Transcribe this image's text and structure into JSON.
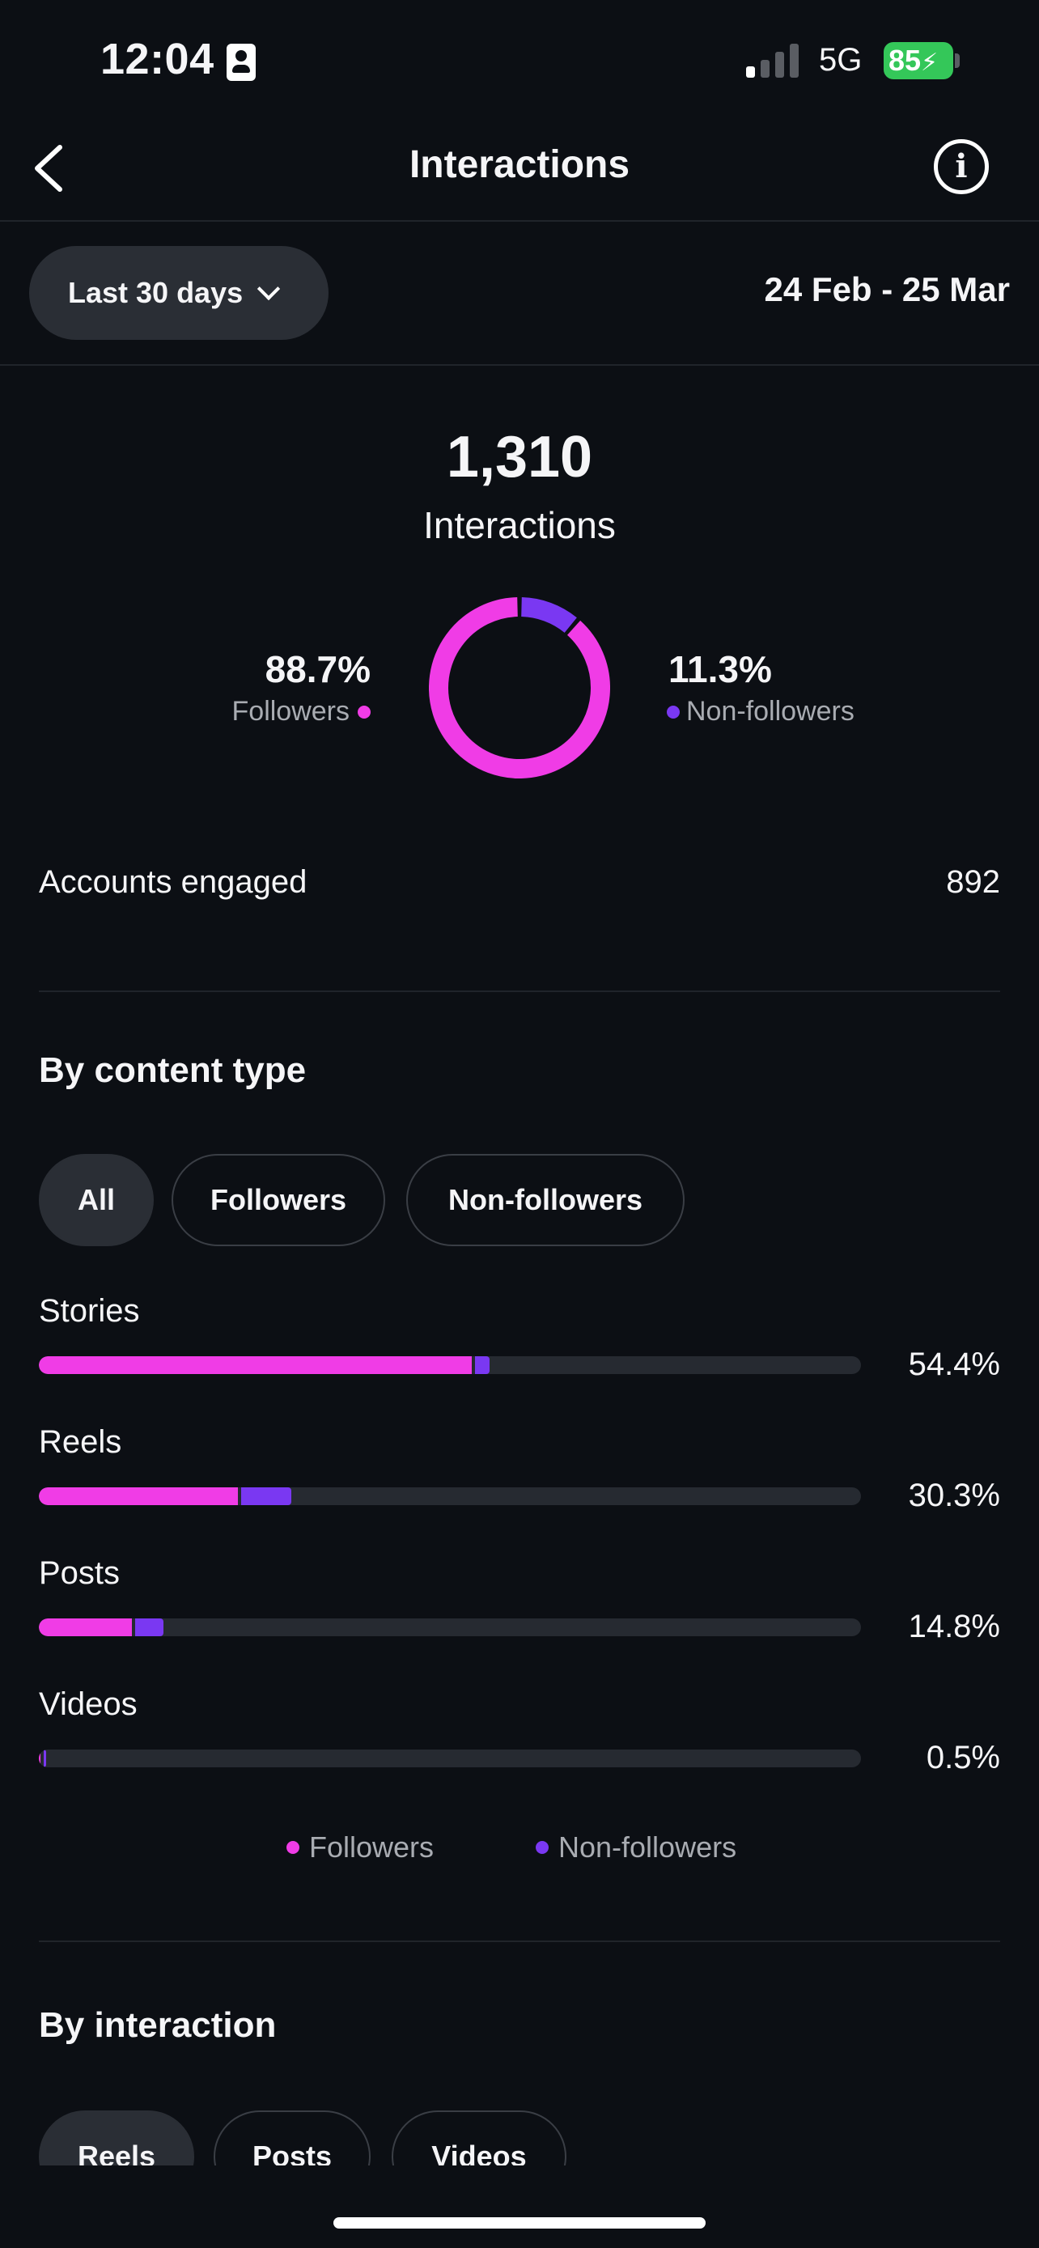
{
  "status_bar": {
    "time": "12:04",
    "network": "5G",
    "battery": "85"
  },
  "header": {
    "title": "Interactions",
    "back_icon": "chevron-left-icon",
    "info_icon": "info-icon"
  },
  "filter": {
    "range_label": "Last 30 days",
    "date_range": "24 Feb - 25 Mar"
  },
  "summary": {
    "total": "1,310",
    "total_label": "Interactions",
    "followers_pct": "88.7%",
    "followers_label": "Followers",
    "non_followers_pct": "11.3%",
    "non_followers_label": "Non-followers",
    "followers_fraction": 0.887,
    "non_followers_fraction": 0.113
  },
  "accounts_engaged": {
    "label": "Accounts engaged",
    "value": "892"
  },
  "content_type": {
    "title": "By content type",
    "chips": [
      "All",
      "Followers",
      "Non-followers"
    ],
    "rows": [
      {
        "label": "Stories",
        "pct": "54.4%",
        "followers": 0.527,
        "non_followers": 0.017
      },
      {
        "label": "Reels",
        "pct": "30.3%",
        "followers": 0.242,
        "non_followers": 0.061
      },
      {
        "label": "Posts",
        "pct": "14.8%",
        "followers": 0.113,
        "non_followers": 0.035
      },
      {
        "label": "Videos",
        "pct": "0.5%",
        "followers": 0.002,
        "non_followers": 0.003
      }
    ],
    "legend": [
      "Followers",
      "Non-followers"
    ]
  },
  "interaction": {
    "title": "By interaction",
    "chips": [
      "Reels",
      "Posts",
      "Videos"
    ]
  },
  "colors": {
    "followers": "#f03ce6",
    "non_followers": "#7a38f2",
    "track": "#262a31"
  }
}
